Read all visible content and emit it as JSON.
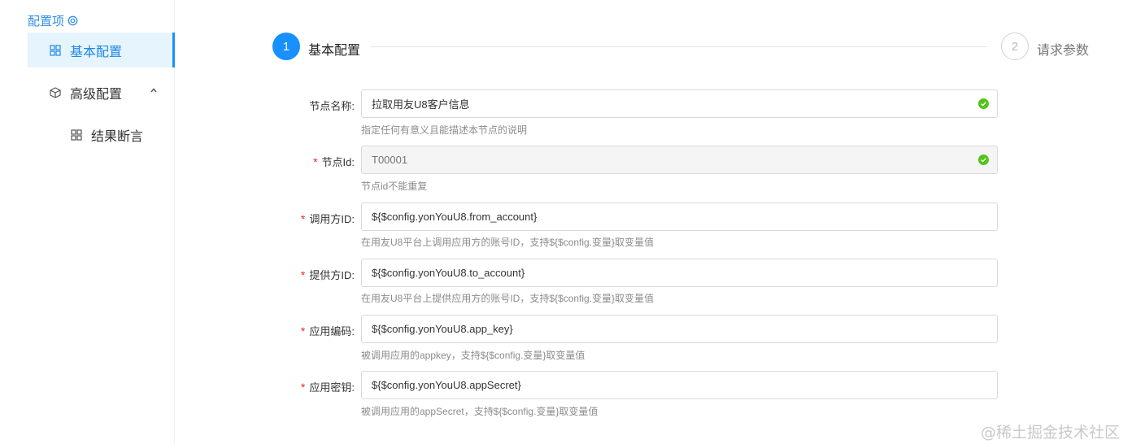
{
  "sidebar": {
    "section_title": "配置项",
    "items": [
      {
        "label": "基本配置",
        "icon": "grid-icon",
        "active": true
      },
      {
        "label": "高级配置",
        "icon": "cube-icon",
        "expanded": true
      },
      {
        "label": "结果断言",
        "icon": "grid-icon"
      }
    ]
  },
  "steps": [
    {
      "number": "1",
      "label": "基本配置",
      "status": "active"
    },
    {
      "number": "2",
      "label": "请求参数",
      "status": "wait"
    }
  ],
  "form": {
    "fields": [
      {
        "label": "节点名称:",
        "required": false,
        "value": "拉取用友U8客户信息",
        "placeholder": "",
        "help": "指定任何有意义且能描述本节点的说明",
        "valid": true,
        "disabled": false
      },
      {
        "label": "节点Id:",
        "required": true,
        "value": "",
        "placeholder": "T00001",
        "help": "节点id不能重复",
        "valid": true,
        "disabled": true
      },
      {
        "label": "调用方ID:",
        "required": true,
        "value": "${$config.yonYouU8.from_account}",
        "placeholder": "",
        "help": "在用友U8平台上调用应用方的账号ID，支持${$config.变量}取变量值",
        "valid": false,
        "disabled": false
      },
      {
        "label": "提供方ID:",
        "required": true,
        "value": "${$config.yonYouU8.to_account}",
        "placeholder": "",
        "help": "在用友U8平台上提供应用方的账号ID，支持${$config.变量}取变量值",
        "valid": false,
        "disabled": false
      },
      {
        "label": "应用编码:",
        "required": true,
        "value": "${$config.yonYouU8.app_key}",
        "placeholder": "",
        "help": "被调用应用的appkey，支持${$config.变量}取变量值",
        "valid": false,
        "disabled": false
      },
      {
        "label": "应用密钥:",
        "required": true,
        "value": "${$config.yonYouU8.appSecret}",
        "placeholder": "",
        "help": "被调用应用的appSecret，支持${$config.变量}取变量值",
        "valid": false,
        "disabled": false
      }
    ]
  },
  "watermark": "@稀土掘金技术社区",
  "colors": {
    "primary": "#1890ff",
    "success": "#52c41a",
    "required": "#f5222d"
  }
}
